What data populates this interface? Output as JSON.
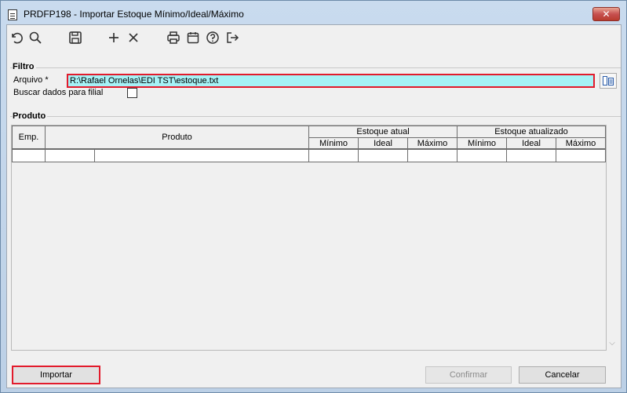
{
  "window": {
    "title": "PRDFP198 - Importar Estoque Mínimo/Ideal/Máximo",
    "close_label": "✕"
  },
  "toolbar": {
    "icons": [
      "undo-icon",
      "search-icon",
      "save-icon",
      "add-icon",
      "delete-icon",
      "print-icon",
      "calendar-icon",
      "help-icon",
      "exit-icon"
    ]
  },
  "filtro": {
    "title": "Filtro",
    "arquivo_label": "Arquivo *",
    "arquivo_value": "R:\\Rafael Ornelas\\EDI TST\\estoque.txt",
    "buscar_label": "Buscar dados para filial",
    "buscar_checked": false
  },
  "produto": {
    "title": "Produto",
    "columns": {
      "emp": "Emp.",
      "produto": "Produto",
      "estoque_atual": "Estoque atual",
      "estoque_atualizado": "Estoque atualizado",
      "minimo": "Mínimo",
      "ideal": "Ideal",
      "maximo": "Máximo"
    }
  },
  "buttons": {
    "importar": "Importar",
    "confirmar": "Confirmar",
    "cancelar": "Cancelar"
  }
}
